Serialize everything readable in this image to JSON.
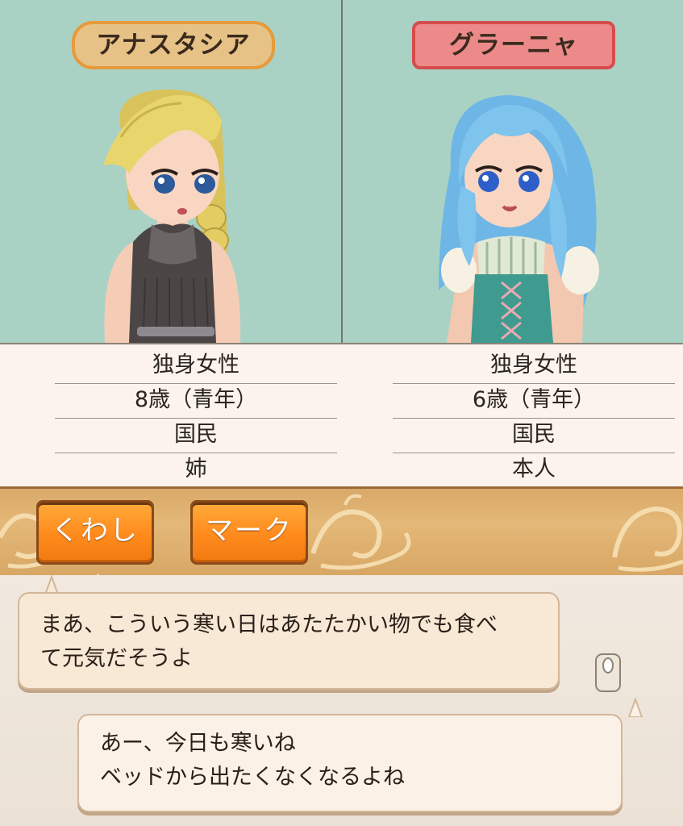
{
  "characters": [
    {
      "name": "アナスタシア",
      "hair_color": "#e8d66c",
      "nameplate_color": "#e7c287",
      "details": [
        "独身女性",
        "8歳（青年）",
        "国民",
        "姉"
      ]
    },
    {
      "name": "グラーニャ",
      "hair_color": "#7fc4ec",
      "nameplate_color": "#eb8a89",
      "details": [
        "独身女性",
        "6歳（青年）",
        "国民",
        "本人"
      ]
    }
  ],
  "actions": {
    "details_label": "くわしく",
    "mark_label": "マーク"
  },
  "conversation": [
    {
      "line1": "まあ、こういう寒い日はあたたかい物でも食べ",
      "line2": "て元気だそうよ"
    },
    {
      "line1": "あー、今日も寒いね",
      "line2": "ベッドから出たくなくなるよね"
    }
  ]
}
